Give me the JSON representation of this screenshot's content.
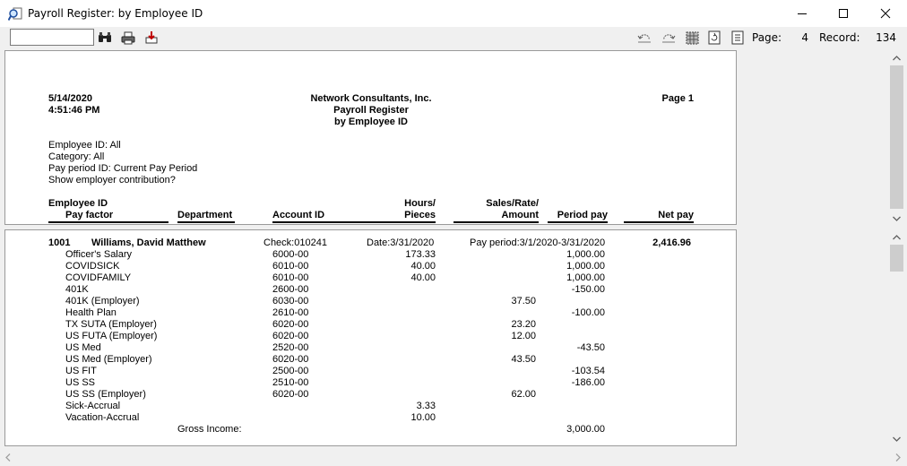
{
  "window": {
    "title": "Payroll Register: by Employee ID",
    "minimize_icon": "minimize-icon",
    "maximize_icon": "maximize-icon",
    "close_icon": "close-icon"
  },
  "toolbar": {
    "search_value": "",
    "find_icon": "binoculars-icon",
    "print_icon": "printer-icon",
    "export_icon": "export-icon",
    "page_label": "Page:",
    "page_value": "4",
    "record_label": "Record:",
    "record_value": "134"
  },
  "report_header": {
    "date": "5/14/2020",
    "time": "4:51:46 PM",
    "company": "Network Consultants, Inc.",
    "report_title": "Payroll Register",
    "report_subtitle": "by Employee ID",
    "page": "Page 1",
    "filters": [
      "Employee ID: All",
      "Category: All",
      "Pay period ID: Current Pay Period",
      "Show employer contribution?"
    ],
    "columns": {
      "employee_id": "Employee ID",
      "pay_factor": "Pay factor",
      "department": "Department",
      "account_id": "Account ID",
      "hours_top": "Hours/",
      "hours_bottom": "Pieces",
      "sales_top": "Sales/Rate/",
      "sales_bottom": "Amount",
      "period_pay": "Period pay",
      "net_pay": "Net pay"
    }
  },
  "employee": {
    "id": "1001",
    "name": "Williams, David Matthew",
    "check": "Check:010241",
    "date": "Date:3/31/2020",
    "pay_period": "Pay period:3/1/2020-3/31/2020",
    "net_pay": "2,416.96",
    "rows": [
      {
        "factor": "Officer's Salary",
        "account": "6000-00",
        "hours": "173.33",
        "amount": "",
        "period_pay": "1,000.00"
      },
      {
        "factor": "COVIDSICK",
        "account": "6010-00",
        "hours": "40.00",
        "amount": "",
        "period_pay": "1,000.00"
      },
      {
        "factor": "COVIDFAMILY",
        "account": "6010-00",
        "hours": "40.00",
        "amount": "",
        "period_pay": "1,000.00"
      },
      {
        "factor": "401K",
        "account": "2600-00",
        "hours": "",
        "amount": "",
        "period_pay": "-150.00"
      },
      {
        "factor": "401K (Employer)",
        "account": "6030-00",
        "hours": "",
        "amount": "37.50",
        "period_pay": ""
      },
      {
        "factor": "Health Plan",
        "account": "2610-00",
        "hours": "",
        "amount": "",
        "period_pay": "-100.00"
      },
      {
        "factor": "TX SUTA (Employer)",
        "account": "6020-00",
        "hours": "",
        "amount": "23.20",
        "period_pay": ""
      },
      {
        "factor": "US FUTA (Employer)",
        "account": "6020-00",
        "hours": "",
        "amount": "12.00",
        "period_pay": ""
      },
      {
        "factor": "US Med",
        "account": "2520-00",
        "hours": "",
        "amount": "",
        "period_pay": "-43.50"
      },
      {
        "factor": "US Med (Employer)",
        "account": "6020-00",
        "hours": "",
        "amount": "43.50",
        "period_pay": ""
      },
      {
        "factor": "US FIT",
        "account": "2500-00",
        "hours": "",
        "amount": "",
        "period_pay": "-103.54"
      },
      {
        "factor": "US SS",
        "account": "2510-00",
        "hours": "",
        "amount": "",
        "period_pay": "-186.00"
      },
      {
        "factor": "US SS (Employer)",
        "account": "6020-00",
        "hours": "",
        "amount": "62.00",
        "period_pay": ""
      },
      {
        "factor": "Sick-Accrual",
        "account": "",
        "hours": "3.33",
        "amount": "",
        "period_pay": ""
      },
      {
        "factor": "Vacation-Accrual",
        "account": "",
        "hours": "10.00",
        "amount": "",
        "period_pay": ""
      }
    ],
    "gross_label": "Gross Income:",
    "gross_value": "3,000.00"
  }
}
